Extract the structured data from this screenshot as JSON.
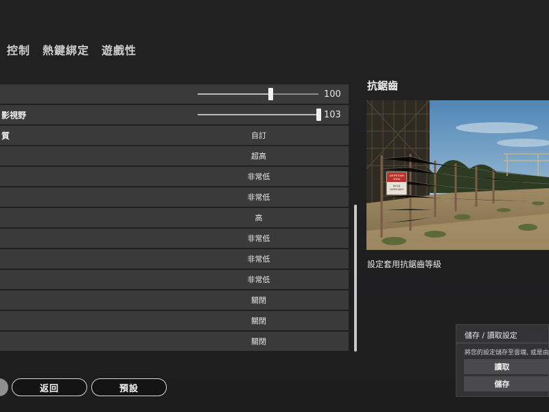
{
  "tabs": [
    "控制",
    "熱鍵綁定",
    "遊戲性"
  ],
  "settings": {
    "sliders": [
      {
        "label": "",
        "value": "100",
        "fraction": 0.605
      },
      {
        "label": "影視野",
        "value": "103",
        "fraction": 1.0
      }
    ],
    "rows": [
      {
        "label": "質",
        "value": "自訂"
      },
      {
        "label": "",
        "value": "超高"
      },
      {
        "label": "",
        "value": "非常低"
      },
      {
        "label": "",
        "value": "非常低"
      },
      {
        "label": "",
        "value": "高"
      },
      {
        "label": "",
        "value": "非常低"
      },
      {
        "label": "",
        "value": "非常低"
      },
      {
        "label": "",
        "value": "非常低"
      },
      {
        "label": "",
        "value": "關閉"
      },
      {
        "label": "",
        "value": "關閉"
      },
      {
        "label": "",
        "value": "關閉"
      }
    ]
  },
  "panel": {
    "title": "抗鋸齒",
    "description": "設定套用抗鋸齒等級",
    "sign_lines": [
      "ЗАПРЕТНАЯ",
      "ЗОНА",
      "ВХОД",
      "ЗАПРЕЩЕН"
    ]
  },
  "saveload": {
    "title": "儲存 / 讀取設定",
    "description": "將您的設定儲存至雲端, 或是由",
    "load_label": "讀取",
    "save_label": "儲存"
  },
  "buttons": {
    "back_label": "返回",
    "default_label": "預設"
  }
}
